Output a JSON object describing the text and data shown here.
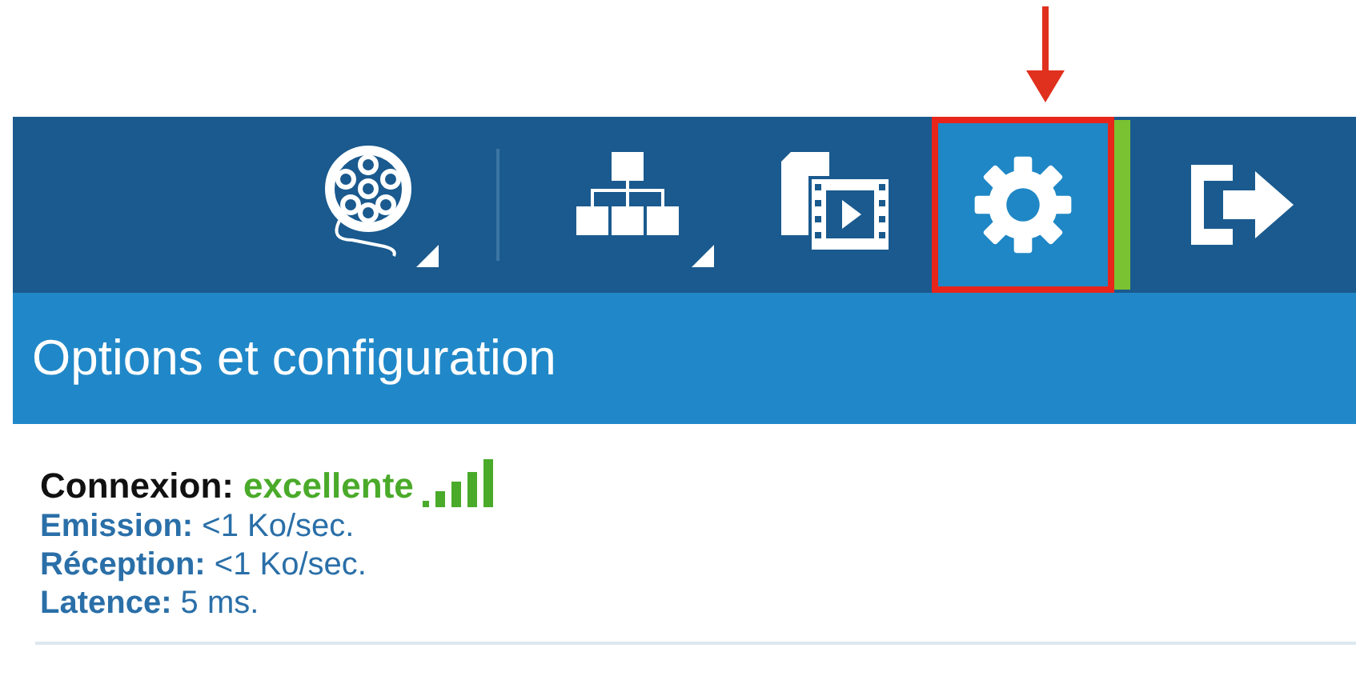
{
  "toolbar": {
    "buttons": [
      {
        "kind": "reel",
        "selected": false,
        "has_menu": true
      },
      {
        "kind": "divider"
      },
      {
        "kind": "sitemap",
        "selected": false,
        "has_menu": true
      },
      {
        "kind": "media",
        "selected": false,
        "has_menu": false
      },
      {
        "kind": "gear",
        "selected": true,
        "has_menu": false
      },
      {
        "kind": "exit",
        "selected": false,
        "has_menu": false
      }
    ]
  },
  "panel": {
    "title": "Options et configuration",
    "connection": {
      "label": "Connexion:",
      "value": "excellente"
    },
    "stats": [
      {
        "label": "Emission:",
        "value": "<1 Ko/sec."
      },
      {
        "label": "Réception:",
        "value": "<1 Ko/sec."
      },
      {
        "label": "Latence:",
        "value": "5 ms."
      }
    ]
  }
}
